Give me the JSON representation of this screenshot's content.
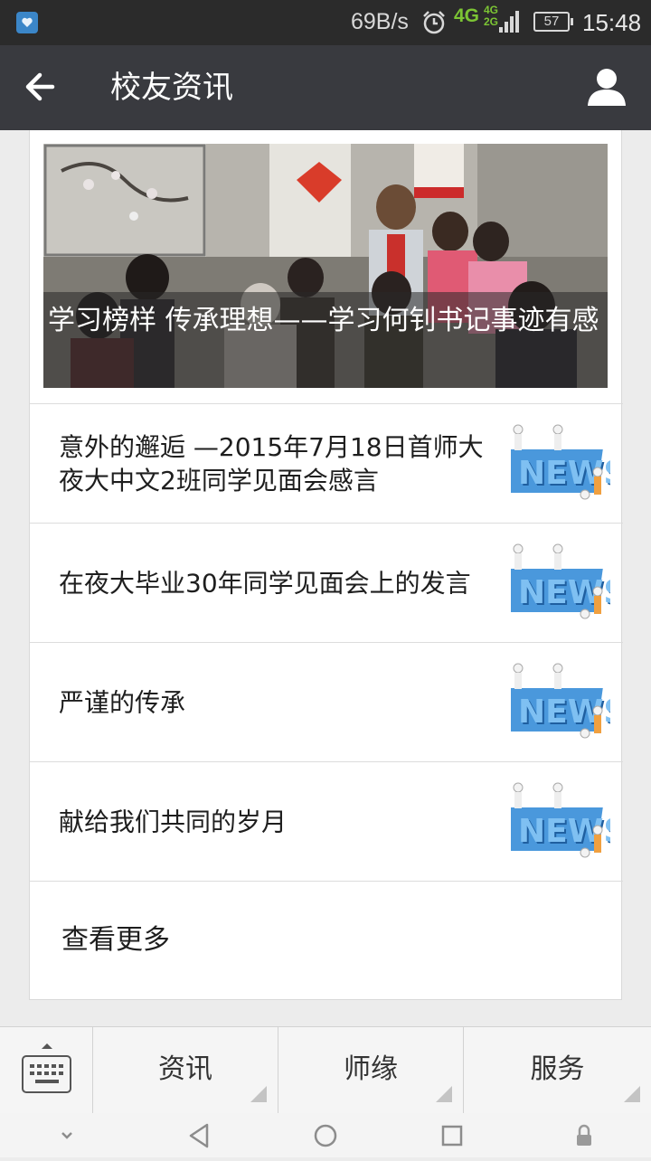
{
  "status_bar": {
    "net_speed": "69B/s",
    "network_type": "4G",
    "network_type_secondary": [
      "4G",
      "2G"
    ],
    "battery": "57",
    "time": "15:48"
  },
  "header": {
    "title": "校友资讯",
    "back_icon": "arrow-left-icon",
    "profile_icon": "person-icon"
  },
  "hero": {
    "caption": "学习榜样 传承理想——学习何钊书记事迹有感"
  },
  "articles": [
    {
      "title": "意外的邂逅 —2015年7月18日首师大夜大中文2班同学见面会感言",
      "thumb_icon": "news-icon"
    },
    {
      "title": "在夜大毕业30年同学见面会上的发言",
      "thumb_icon": "news-icon"
    },
    {
      "title": "严谨的传承",
      "thumb_icon": "news-icon"
    },
    {
      "title": "献给我们共同的岁月",
      "thumb_icon": "news-icon"
    }
  ],
  "more": {
    "label": "查看更多"
  },
  "bottom_menu": {
    "keyboard_icon": "keyboard-icon",
    "tabs": [
      {
        "label": "资讯"
      },
      {
        "label": "师缘"
      },
      {
        "label": "服务"
      }
    ]
  },
  "colors": {
    "title_bar": "#393a3f",
    "status_bar": "#2b2b2b",
    "network_green": "#7cc534",
    "news_blue": "#3b8fd6"
  }
}
